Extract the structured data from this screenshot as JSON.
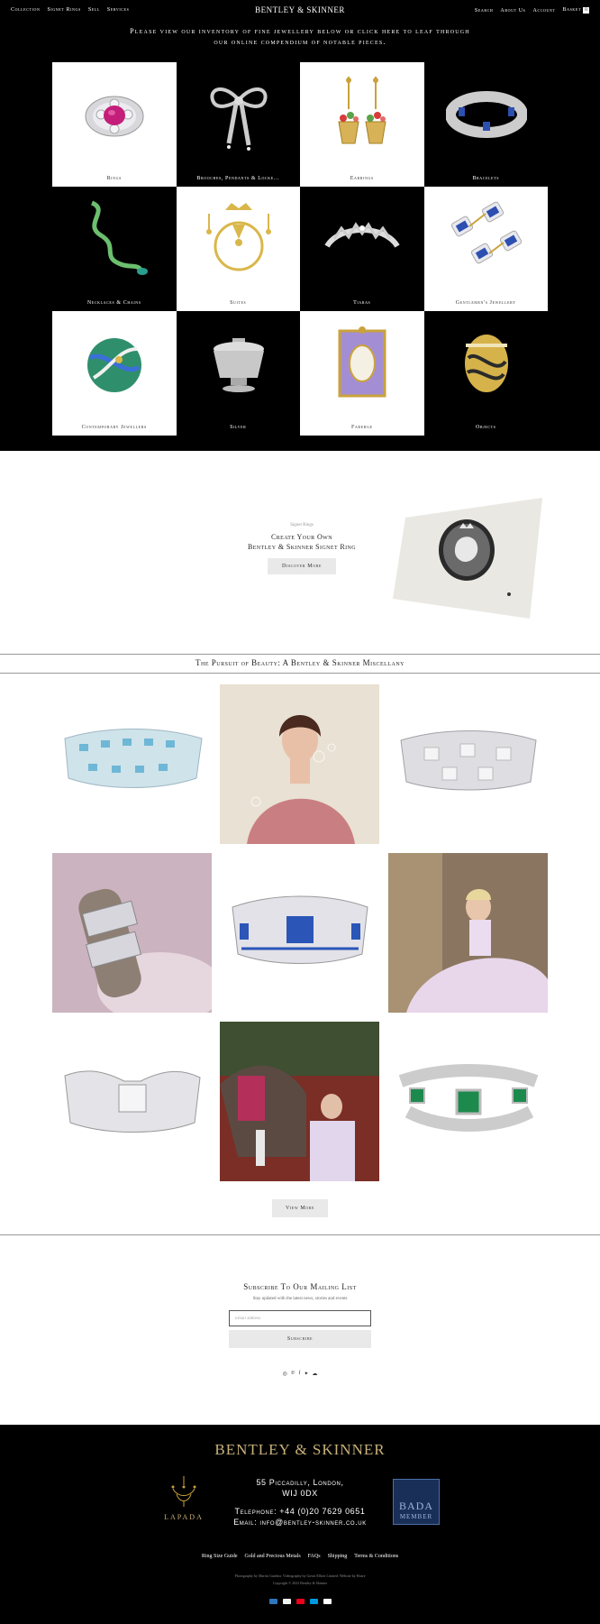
{
  "nav": {
    "left": [
      "Collection",
      "Signet Rings",
      "Sell",
      "Services"
    ],
    "right": [
      "Search",
      "About Us",
      "Account",
      "Basket"
    ],
    "basket_count": "0",
    "brand": "BENTLEY & SKINNER"
  },
  "intro": "Please view our inventory of fine jewellery below or click here to leaf through our online compendium of notable pieces.",
  "categories": [
    {
      "label": "Rings",
      "icon": "ruby-ring-icon"
    },
    {
      "label": "Brooches, Pendants & Locke...",
      "icon": "bow-brooch-icon"
    },
    {
      "label": "Earrings",
      "icon": "basket-earrings-icon"
    },
    {
      "label": "Bracelets",
      "icon": "sapphire-bracelet-icon"
    },
    {
      "label": "Necklaces & Chains",
      "icon": "snake-necklace-icon"
    },
    {
      "label": "Suites",
      "icon": "gold-suite-icon"
    },
    {
      "label": "Tiaras",
      "icon": "tiara-icon"
    },
    {
      "label": "Gentlemen's Jewellery",
      "icon": "cufflinks-icon"
    },
    {
      "label": "Contemporary Jewellers",
      "icon": "enamel-sphere-icon"
    },
    {
      "label": "Silver",
      "icon": "silver-tureen-icon"
    },
    {
      "label": "Faberge",
      "icon": "faberge-frame-icon"
    },
    {
      "label": "Objects",
      "icon": "gold-egg-icon"
    }
  ],
  "signet": {
    "kicker": "Signet Rings",
    "title_line1": "Create Your Own",
    "title_line2": "Bentley & Skinner Signet Ring",
    "button": "Discover More"
  },
  "pursuit_title": "The Pursuit of Beauty: A Bentley & Skinner Miscellany",
  "view_more": "View More",
  "subscribe": {
    "title": "Subscribe To Our Mailing List",
    "text": "Stay updated with the latest news, stories and events",
    "placeholder": "Email address",
    "button": "Subscribe"
  },
  "social": [
    "instagram-icon",
    "pinterest-icon",
    "facebook-icon",
    "twitter-icon",
    "wechat-icon"
  ],
  "footer": {
    "brand": "BENTLEY & SKINNER",
    "address1": "55 Piccadilly, London,",
    "address2": "WIJ 0DX",
    "telephone": "Telephone: +44 (0)20 7629 0651",
    "email": "Email: info@bentley-skinner.co.uk",
    "lapada": "LAPADA",
    "bada_line1": "BADA",
    "bada_line2": "MEMBER",
    "links": [
      "Ring Size Guide",
      "Gold and Precious Metals",
      "FAQs",
      "Shipping",
      "Terms & Conditions"
    ],
    "credit": "Photography by Martin Gunthor. Videography by Gavin Elliott Limited. Website by Hoare",
    "copyright": "Copyright © 2022 Bentley & Skinner",
    "payments": [
      {
        "name": "amex",
        "color": "#2e77bc"
      },
      {
        "name": "visa",
        "color": "#1a1f71"
      },
      {
        "name": "mastercard",
        "color": "#eb001b"
      },
      {
        "name": "maestro",
        "color": "#0099df"
      },
      {
        "name": "applepay",
        "color": "#ffffff"
      }
    ]
  }
}
